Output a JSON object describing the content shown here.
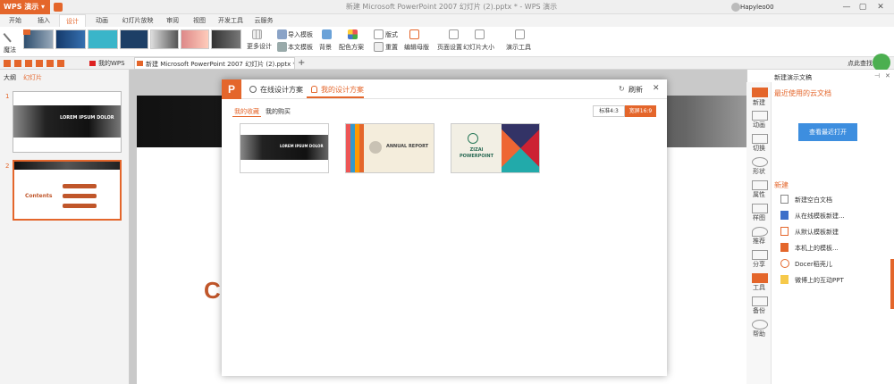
{
  "app": {
    "name": "WPS 演示",
    "doc_title": "新建 Microsoft PowerPoint 2007 幻灯片 (2).pptx * - WPS 演示",
    "user": "Hapyleo00"
  },
  "ribbon_tabs": [
    "开始",
    "插入",
    "设计",
    "动画",
    "幻灯片放映",
    "审阅",
    "视图",
    "开发工具",
    "云服务"
  ],
  "ribbon": {
    "magic_label": "魔法",
    "more_design": "更多设计",
    "import_template": "导入模板",
    "this_template": "本文模板",
    "background": "背景",
    "color_scheme": "配色方案",
    "layout": "版式",
    "reset": "重置",
    "edit_master": "编辑母版",
    "page_setup": "页面设置",
    "slide_size": "幻灯片大小",
    "present_tools": "演示工具"
  },
  "doc_tabs": {
    "my_wps": "我的WPS",
    "current": "新建 Microsoft PowerPoint 2007 幻灯片 (2).pptx *",
    "search": "点此查找命"
  },
  "left_panel": {
    "tab_outline": "大纲",
    "tab_slides": "幻灯片",
    "slide1_number": "1",
    "slide1_title": "LOREM IPSUM DOLOR",
    "slide2_number": "2",
    "slide2_title": "Contents"
  },
  "canvas": {
    "partial_title": "C"
  },
  "dialog": {
    "tab_online": "在线设计方案",
    "tab_mine": "我的设计方案",
    "refresh": "刷新",
    "subtab_fav": "我的收藏",
    "subtab_bought": "我的购买",
    "ratio_4_3": "标准4:3",
    "ratio_16_9": "宽屏16:9",
    "card1_title": "LOREM IPSUM DOLOR",
    "card2_title": "ANNUAL REPORT",
    "card3_title": "ZIZAI POWERPOINT"
  },
  "right_panel": {
    "header": "新建演示文稿",
    "recent_title": "最近使用的云文档",
    "open_recent": "查看最近打开",
    "new_title": "新建",
    "new_items": [
      "新建空白文档",
      "从在线模板新建...",
      "从默认模板新建",
      "本机上的模板...",
      "Docer稻壳儿",
      "微博上的互动PPT"
    ],
    "side_labels": [
      "新建",
      "动画",
      "切换",
      "形状",
      "属性",
      "样图",
      "推荐",
      "分享",
      "工具",
      "备份",
      "帮助"
    ]
  },
  "colors": {
    "accent": "#e4662b",
    "dialog_blue": "#3d8edf"
  }
}
